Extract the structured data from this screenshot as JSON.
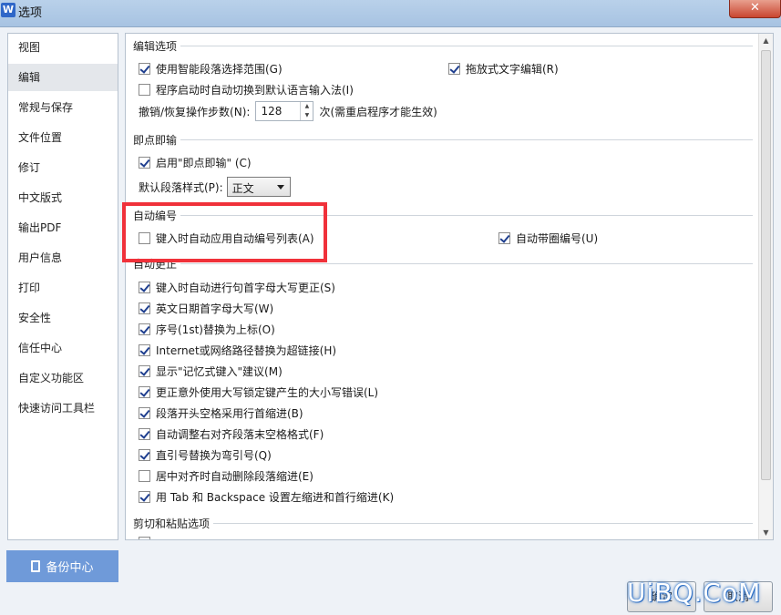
{
  "window": {
    "title": "选项",
    "app_icon": "W",
    "close": "✕"
  },
  "sidebar": {
    "items": [
      {
        "label": "视图"
      },
      {
        "label": "编辑",
        "active": true
      },
      {
        "label": "常规与保存"
      },
      {
        "label": "文件位置"
      },
      {
        "label": "修订"
      },
      {
        "label": "中文版式"
      },
      {
        "label": "输出PDF"
      },
      {
        "label": "用户信息"
      },
      {
        "label": "打印"
      },
      {
        "label": "安全性"
      },
      {
        "label": "信任中心"
      },
      {
        "label": "自定义功能区"
      },
      {
        "label": "快速访问工具栏"
      }
    ],
    "backup_label": "备份中心"
  },
  "edit": {
    "title": "编辑选项",
    "smart_para": {
      "label": "使用智能段落选择范围(G)",
      "checked": true
    },
    "drag_text": {
      "label": "拖放式文字编辑(R)",
      "checked": true
    },
    "auto_ime": {
      "label": "程序启动时自动切换到默认语言输入法(I)",
      "checked": false
    },
    "undo_label": "撤销/恢复操作步数(N):",
    "undo_value": "128",
    "undo_suffix": "次(需重启程序才能生效)"
  },
  "click_type": {
    "title": "即点即输",
    "enable": {
      "label": "启用\"即点即输\" (C)",
      "checked": true
    },
    "default_style_label": "默认段落样式(P):",
    "default_style_value": "正文"
  },
  "auto_number": {
    "title": "自动编号",
    "apply_list": {
      "label": "键入时自动应用自动编号列表(A)",
      "checked": false
    },
    "circle_number": {
      "label": "自动带圈编号(U)",
      "checked": true
    }
  },
  "auto_correct": {
    "title": "自动更正",
    "options": [
      {
        "label": "键入时自动进行句首字母大写更正(S)",
        "checked": true
      },
      {
        "label": "英文日期首字母大写(W)",
        "checked": true
      },
      {
        "label": "序号(1st)替换为上标(O)",
        "checked": true
      },
      {
        "label": "Internet或网络路径替换为超链接(H)",
        "checked": true
      },
      {
        "label": "显示\"记忆式键入\"建议(M)",
        "checked": true
      },
      {
        "label": "更正意外使用大写锁定键产生的大小写错误(L)",
        "checked": true
      },
      {
        "label": "段落开头空格采用行首缩进(B)",
        "checked": true
      },
      {
        "label": "自动调整右对齐段落末空格格式(F)",
        "checked": true
      },
      {
        "label": "直引号替换为弯引号(Q)",
        "checked": true
      },
      {
        "label": "居中对齐时自动删除段落缩进(E)",
        "checked": false
      },
      {
        "label": "用 Tab 和 Backspace 设置左缩进和首行缩进(K)",
        "checked": true
      }
    ]
  },
  "cut_paste": {
    "title": "剪切和粘贴选项"
  },
  "buttons": {
    "ok": "确定",
    "cancel": "取消"
  },
  "watermark": "UiBQ.CoM",
  "colors": {
    "highlight": "#f0313a",
    "accent": "#6f9ad9",
    "check": "#1f3f8f"
  }
}
